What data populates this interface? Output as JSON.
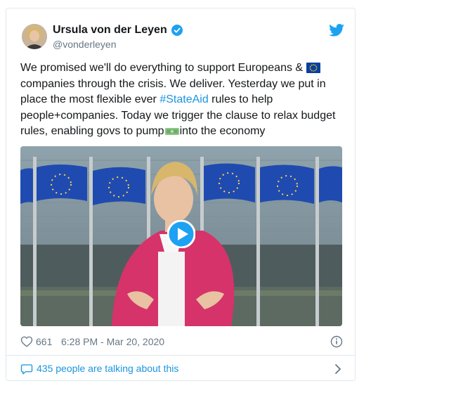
{
  "tweet": {
    "author_name": "Ursula von der Leyen",
    "handle": "@vonderleyen",
    "text_part1": "We promised we'll do everything to support Europeans & ",
    "text_part2": " companies through the crisis. We deliver. Yesterday we put in place the most flexible ever ",
    "hashtag": "#StateAid",
    "text_part3": " rules to help people+companies. Today we trigger the clause to relax budget rules, enabling govs to pump",
    "text_part4": "into the economy",
    "likes": "661",
    "timestamp": "6:28 PM - Mar 20, 2020",
    "talking": "435 people are talking about this"
  },
  "icons": {
    "verified": "verified-badge-icon",
    "twitter": "twitter-bird-icon",
    "eu_flag": "eu-flag-emoji",
    "money": "money-emoji",
    "play": "play-icon",
    "heart": "heart-icon",
    "info": "info-icon",
    "bubble": "speech-bubble-icon",
    "chevron": "chevron-right-icon"
  },
  "colors": {
    "accent": "#1da1f2",
    "link": "#1b95e0",
    "muted": "#657786",
    "border": "#e1e8ed"
  }
}
